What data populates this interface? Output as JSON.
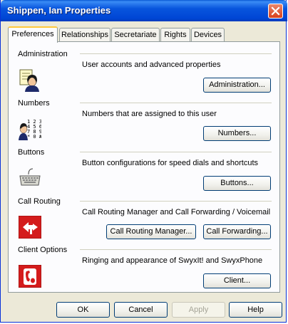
{
  "window": {
    "title": "Shippen, Ian Properties"
  },
  "tabs": [
    {
      "label": "Preferences",
      "active": true
    },
    {
      "label": "Relationships",
      "active": false
    },
    {
      "label": "Secretariate",
      "active": false
    },
    {
      "label": "Rights",
      "active": false
    },
    {
      "label": "Devices",
      "active": false
    }
  ],
  "sections": {
    "administration": {
      "title": "Administration",
      "description": "User accounts and advanced properties",
      "icon": "user-account-icon",
      "button": "Administration..."
    },
    "numbers": {
      "title": "Numbers",
      "description": "Numbers that are assigned to this user",
      "icon": "phone-numbers-icon",
      "button": "Numbers..."
    },
    "buttons": {
      "title": "Buttons",
      "description": "Button configurations for speed dials and shortcuts",
      "icon": "keyboard-icon",
      "button": "Buttons..."
    },
    "call_routing": {
      "title": "Call Routing",
      "description": "Call Routing Manager and Call Forwarding / Voicemail",
      "icon": "call-routing-icon",
      "buttons": [
        "Call Routing Manager...",
        "Call Forwarding..."
      ]
    },
    "client_options": {
      "title": "Client Options",
      "description": "Ringing and appearance of SwyxIt! and SwyxPhone",
      "icon": "client-phone-icon",
      "button": "Client..."
    }
  },
  "footer": {
    "ok": "OK",
    "cancel": "Cancel",
    "apply": "Apply",
    "apply_enabled": false,
    "help": "Help"
  },
  "colors": {
    "titlebar": "#0054e3",
    "dialog_bg": "#ece9d8",
    "panel_bg": "#fcfcfe",
    "close_button": "#d8401c",
    "active_tab_highlight": "#ffc83c",
    "routing_icon_red": "#d41c1c"
  }
}
